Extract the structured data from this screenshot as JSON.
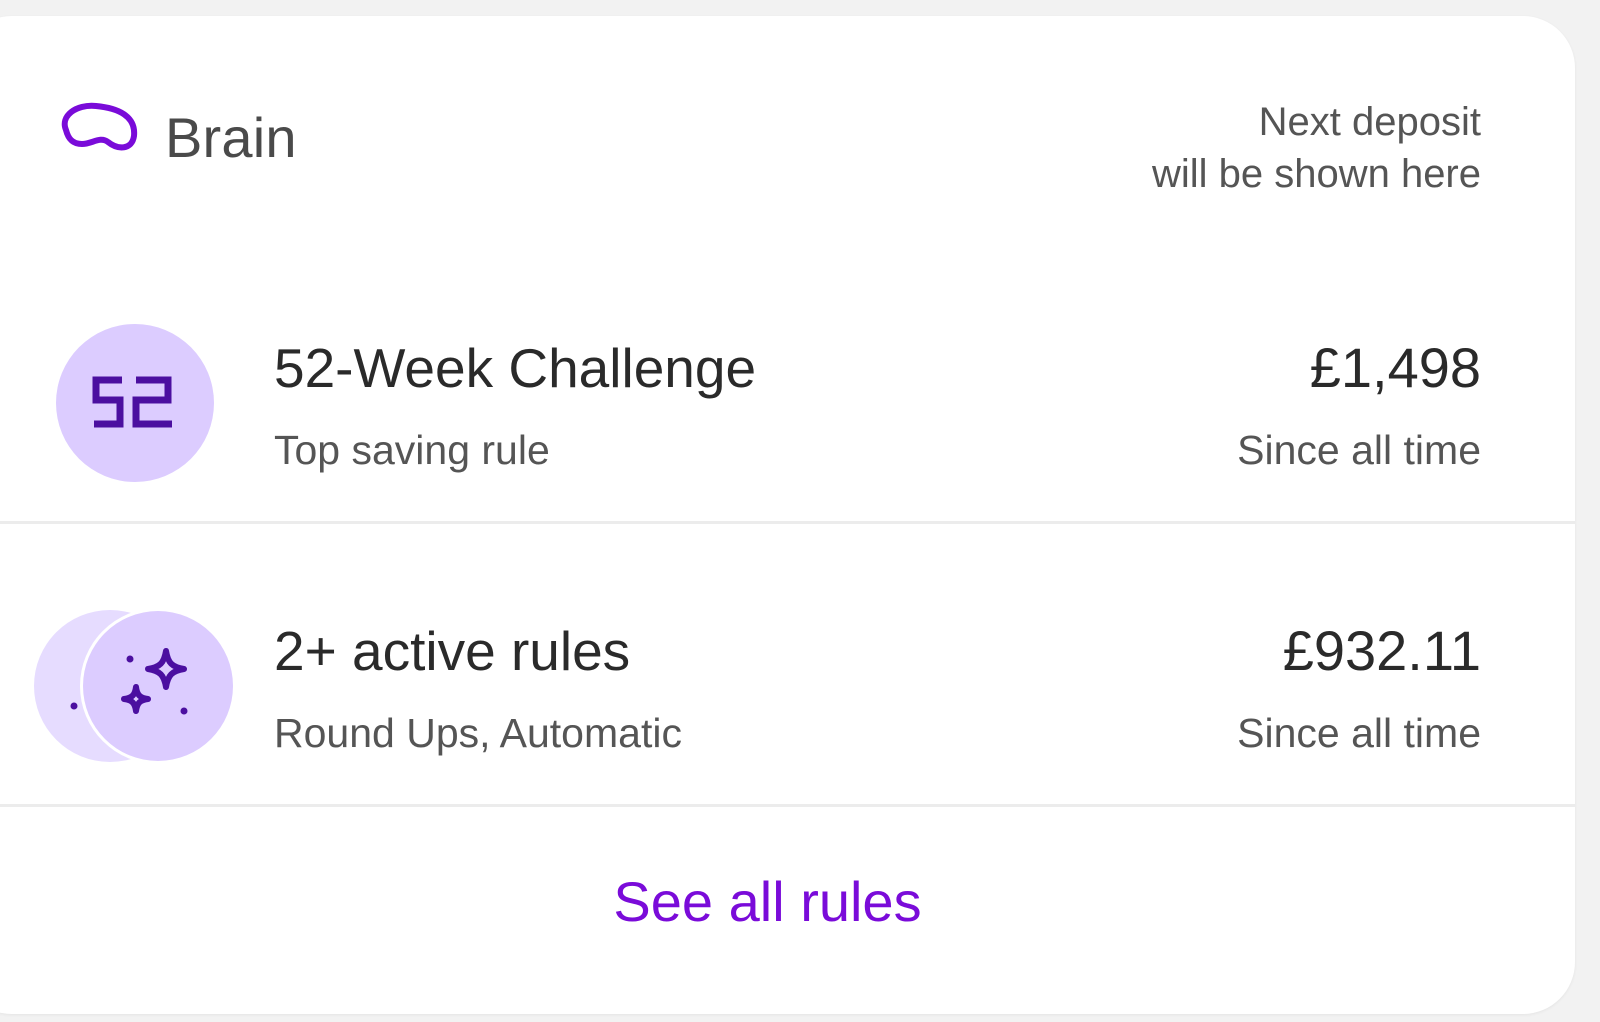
{
  "header": {
    "title": "Brain",
    "next_deposit_line1": "Next deposit",
    "next_deposit_line2": "will be shown here"
  },
  "rules": [
    {
      "badge_text": "52",
      "title": "52-Week Challenge",
      "subtitle": "Top saving rule",
      "amount": "£1,498",
      "amount_sub": "Since all time"
    },
    {
      "badge_icon": "sparkles-icon",
      "title": "2+ active rules",
      "subtitle": "Round Ups, Automatic",
      "amount": "£932.11",
      "amount_sub": "Since all time"
    }
  ],
  "footer": {
    "see_all_label": "See all rules"
  },
  "colors": {
    "accent": "#7a0bd9",
    "badge_bg": "#dcccff",
    "badge_fg": "#4b0fa0",
    "text_primary": "#2a2a2a",
    "text_secondary": "#555555"
  }
}
